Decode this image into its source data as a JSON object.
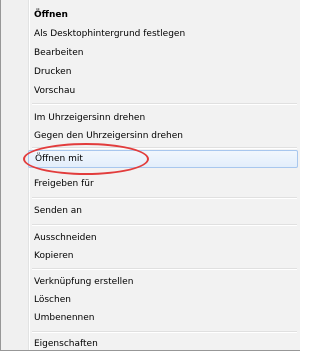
{
  "menu": {
    "items": [
      {
        "label": "Öffnen"
      },
      {
        "label": "Als Desktophintergrund festlegen"
      },
      {
        "label": "Bearbeiten"
      },
      {
        "label": "Drucken"
      },
      {
        "label": "Vorschau"
      },
      {
        "label": "Im Uhrzeigersinn drehen"
      },
      {
        "label": "Gegen den Uhrzeigersinn drehen"
      },
      {
        "label": "Öffnen mit"
      },
      {
        "label": "Freigeben für"
      },
      {
        "label": "Senden an"
      },
      {
        "label": "Ausschneiden"
      },
      {
        "label": "Kopieren"
      },
      {
        "label": "Verknüpfung erstellen"
      },
      {
        "label": "Löschen"
      },
      {
        "label": "Umbenennen"
      },
      {
        "label": "Eigenschaften"
      }
    ]
  },
  "colors": {
    "highlight_ellipse": "#e23c3c",
    "hover_border": "#a8c7ee"
  }
}
